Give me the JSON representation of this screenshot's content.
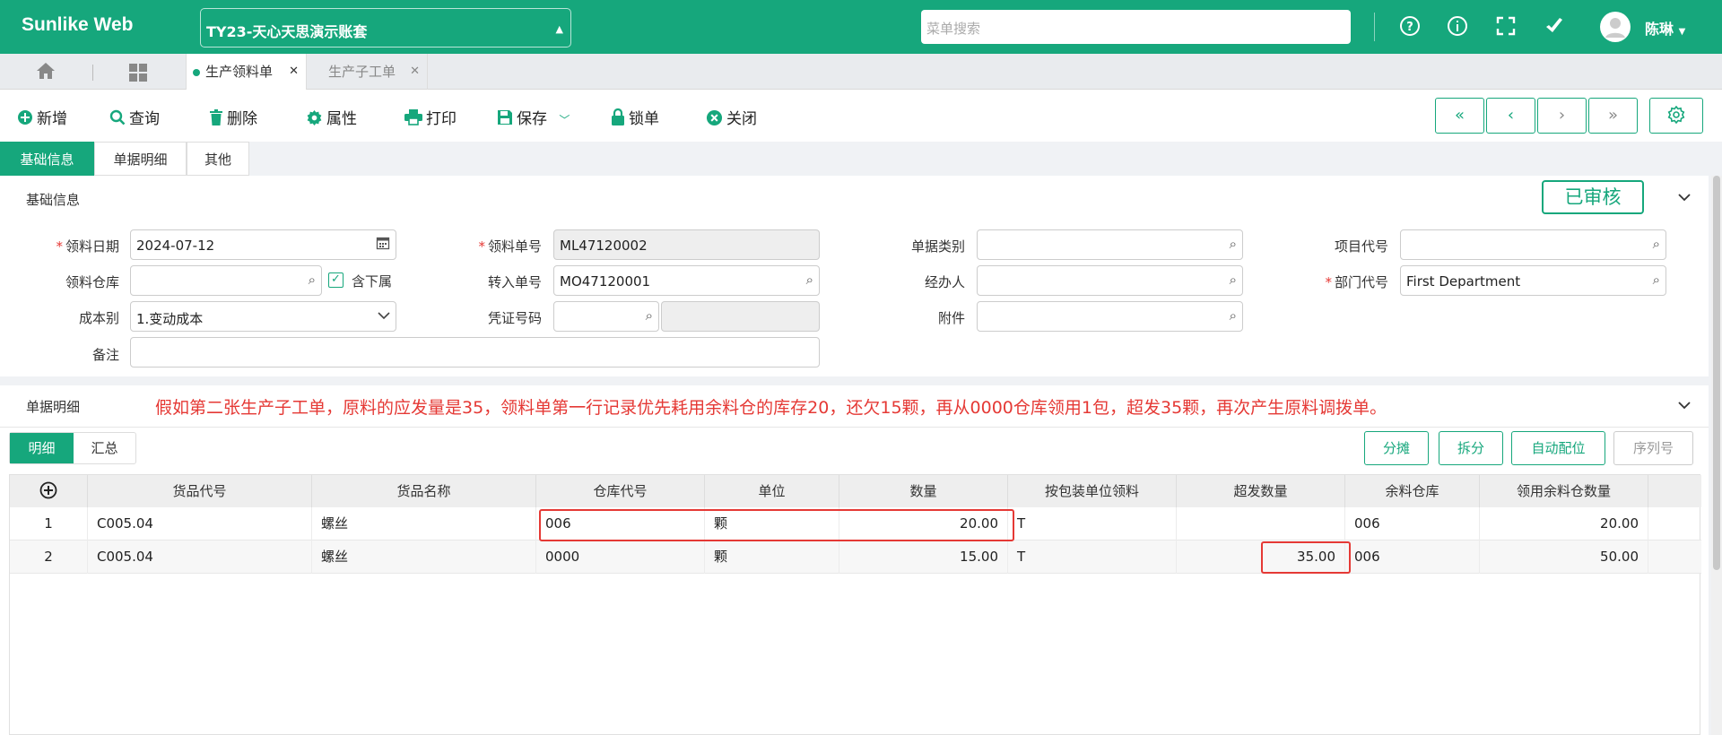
{
  "header": {
    "logo": "Sunlike Web",
    "account": "TY23-天心天思演示账套",
    "search_placeholder": "菜单搜索",
    "user": "陈琳"
  },
  "tabs": [
    {
      "label": "生产领料单",
      "active": true
    },
    {
      "label": "生产子工单",
      "active": false
    }
  ],
  "toolbar": {
    "new": "新增",
    "query": "查询",
    "delete": "删除",
    "props": "属性",
    "print": "打印",
    "save": "保存",
    "lock": "锁单",
    "close": "关闭"
  },
  "section_tabs": [
    "基础信息",
    "单据明细",
    "其他"
  ],
  "basic": {
    "title": "基础信息",
    "status": "已审核",
    "labels": {
      "date": "领料日期",
      "no": "领料单号",
      "doc_type": "单据类别",
      "project": "项目代号",
      "warehouse": "领料仓库",
      "include_sub": "含下属",
      "transfer_no": "转入单号",
      "handler": "经办人",
      "dept": "部门代号",
      "cost": "成本别",
      "voucher": "凭证号码",
      "attach": "附件",
      "remark": "备注"
    },
    "values": {
      "date": "2024-07-12",
      "no": "ML47120002",
      "doc_type": "",
      "project": "",
      "warehouse": "",
      "transfer_no": "MO47120001",
      "handler": "",
      "dept": "First Department",
      "cost": "1.变动成本",
      "voucher": "",
      "attach": "",
      "remark": ""
    }
  },
  "detail": {
    "title": "单据明细",
    "notice": "假如第二张生产子工单，原料的应发量是35，领料单第一行记录优先耗用余料仓的库存20，还欠15颗，再从0000仓库领用1包，超发35颗，再次产生原料调拨单。",
    "sub_tabs": [
      "明细",
      "汇总"
    ],
    "buttons": [
      "分摊",
      "拆分",
      "自动配位",
      "序列号"
    ],
    "columns": [
      "货品代号",
      "货品名称",
      "仓库代号",
      "单位",
      "数量",
      "按包装单位领料",
      "超发数量",
      "余料仓库",
      "领用余料仓数量"
    ],
    "rows": [
      {
        "no": "1",
        "code": "C005.04",
        "name": "螺丝",
        "wh": "006",
        "unit": "颗",
        "qty": "20.00",
        "pack": "T",
        "over": "",
        "rem_wh": "006",
        "rem_qty": "20.00"
      },
      {
        "no": "2",
        "code": "C005.04",
        "name": "螺丝",
        "wh": "0000",
        "unit": "颗",
        "qty": "15.00",
        "pack": "T",
        "over": "35.00",
        "rem_wh": "006",
        "rem_qty": "50.00"
      }
    ]
  },
  "colors": {
    "brand": "#16a77c",
    "highlight": "#e53935"
  }
}
